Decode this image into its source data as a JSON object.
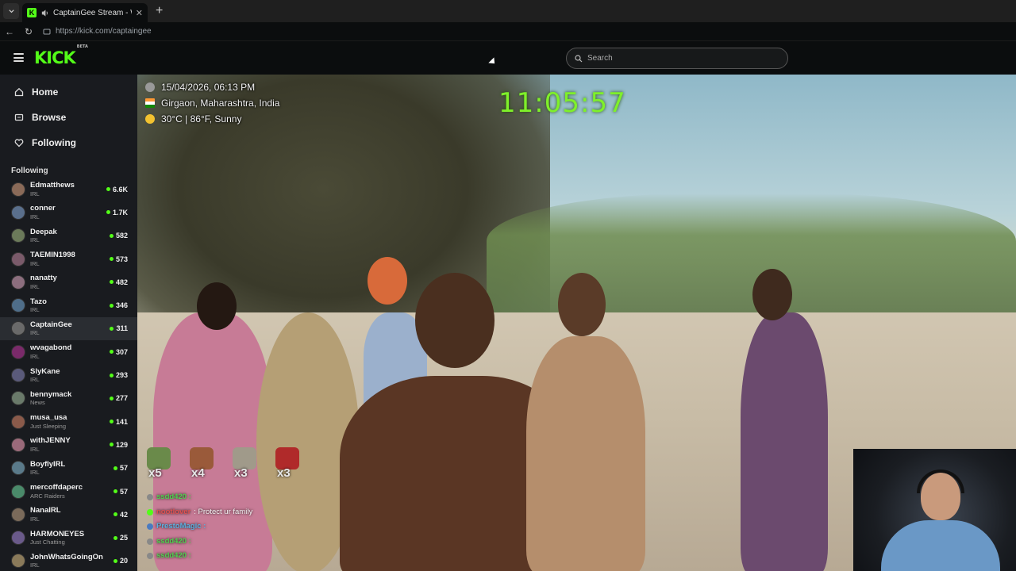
{
  "browser": {
    "tab_title": "CaptainGee Stream - Watch Li",
    "url": "https://kick.com/captaingee"
  },
  "header": {
    "logo_text": "KICK",
    "logo_badge": "BETA",
    "search_placeholder": "Search",
    "accent": "#53fc18"
  },
  "sidebar": {
    "nav": [
      {
        "label": "Home",
        "icon": "home-icon"
      },
      {
        "label": "Browse",
        "icon": "browse-icon"
      },
      {
        "label": "Following",
        "icon": "heart-icon"
      }
    ],
    "following_title": "Following",
    "channels": [
      {
        "name": "Edmatthews",
        "category": "IRL",
        "viewers": "6.6K",
        "color": "#8a6a58"
      },
      {
        "name": "conner",
        "category": "IRL",
        "viewers": "1.7K",
        "color": "#5a6f8c"
      },
      {
        "name": "Deepak",
        "category": "IRL",
        "viewers": "582",
        "color": "#6b7a5a"
      },
      {
        "name": "TAEMIN1998",
        "category": "IRL",
        "viewers": "573",
        "color": "#7a5a6a"
      },
      {
        "name": "nanatty",
        "category": "IRL",
        "viewers": "482",
        "color": "#8c6e7e"
      },
      {
        "name": "Tazo",
        "category": "IRL",
        "viewers": "346",
        "color": "#4f6e8a"
      },
      {
        "name": "CaptainGee",
        "category": "IRL",
        "viewers": "311",
        "color": "#6a6a6a"
      },
      {
        "name": "wvagabond",
        "category": "IRL",
        "viewers": "307",
        "color": "#7a2a6a"
      },
      {
        "name": "SlyKane",
        "category": "IRL",
        "viewers": "293",
        "color": "#5a5a7a"
      },
      {
        "name": "bennymack",
        "category": "News",
        "viewers": "277",
        "color": "#6a7a6a"
      },
      {
        "name": "musa_usa",
        "category": "Just Sleeping",
        "viewers": "141",
        "color": "#8a5a4a"
      },
      {
        "name": "withJENNY",
        "category": "IRL",
        "viewers": "129",
        "color": "#9a6a7a"
      },
      {
        "name": "BoyflyIRL",
        "category": "IRL",
        "viewers": "57",
        "color": "#5a7a8a"
      },
      {
        "name": "mercoffdaperc",
        "category": "ARC Raiders",
        "viewers": "57",
        "color": "#4a8a6a"
      },
      {
        "name": "NanaIRL",
        "category": "IRL",
        "viewers": "42",
        "color": "#7a6a5a"
      },
      {
        "name": "HARMONEYES",
        "category": "Just Chatting",
        "viewers": "25",
        "color": "#6a5a8a"
      },
      {
        "name": "JohnWhatsGoingOn",
        "category": "IRL",
        "viewers": "20",
        "color": "#8a7a5a"
      }
    ]
  },
  "stream": {
    "overlay": {
      "datetime": "15/04/2026, 06:13 PM",
      "location": "Girgaon, Maharashtra, India",
      "weather": "30°C | 86°F, Sunny",
      "clock": "11:05:57"
    },
    "gifts": [
      {
        "count": "x5",
        "color": "#6a8a4a"
      },
      {
        "count": "x4",
        "color": "#9a5a3a"
      },
      {
        "count": "x3",
        "color": "#a09a8a"
      },
      {
        "count": "x3",
        "color": "#b02a2a"
      }
    ],
    "chat": [
      {
        "user": "ssdd420 :",
        "text": "",
        "user_color": "#4fd14f",
        "badge_color": "#888888"
      },
      {
        "user": "nootlover",
        "text": ": Protect ur family",
        "user_color": "#e05050",
        "badge_color": "#53fc18"
      },
      {
        "user": "PrestoMagic :",
        "text": "",
        "user_color": "#5ab0e0",
        "badge_color": "#4a7ac0"
      },
      {
        "user": "ssdd420 :",
        "text": "",
        "user_color": "#4fd14f",
        "badge_color": "#888888"
      },
      {
        "user": "ssdd420 :",
        "text": "",
        "user_color": "#4fd14f",
        "badge_color": "#888888"
      }
    ]
  }
}
